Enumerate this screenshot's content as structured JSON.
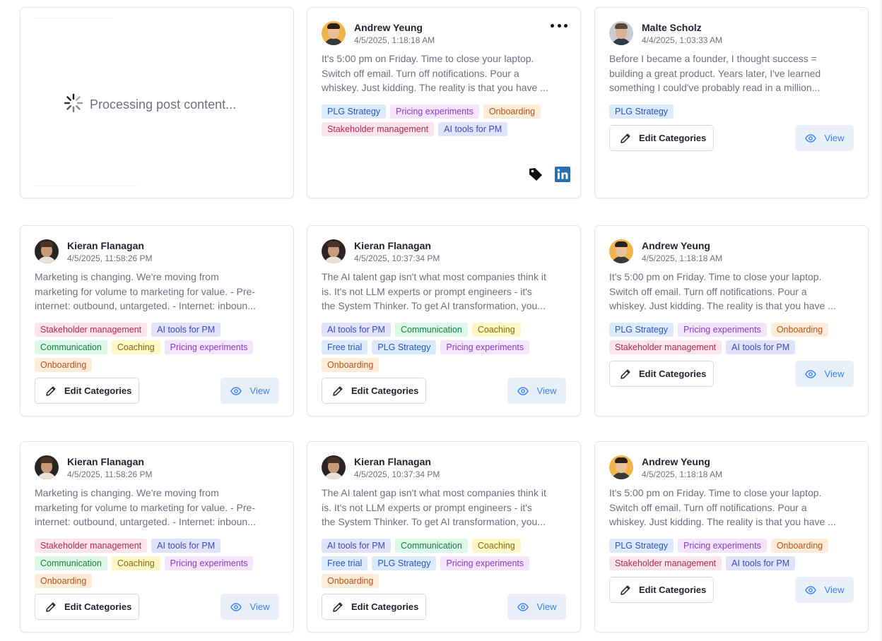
{
  "processing_card": {
    "label": "Processing post content..."
  },
  "labels": {
    "edit": "Edit Categories",
    "view": "View"
  },
  "colors": {
    "view_accent": "#3b82f6",
    "linkedin": "#2a6fb0",
    "tag_blue": "#dbeafe",
    "tag_indigo": "#e0e3fc",
    "tag_purple": "#f2e5fd",
    "tag_orange": "#feecd8",
    "tag_pink": "#fce4ec",
    "tag_green": "#dcf7e5",
    "tag_yellow": "#fef6c4"
  },
  "posts": [
    {
      "author": "Andrew Yeung",
      "date": "4/5/2025, 1:18:18 AM",
      "lines": [
        "It's 5:00 pm on Friday. Time to close your laptop.",
        "Switch off email. Turn off notifications. Pour a",
        "whiskey. Just kidding. The reality is that you have ..."
      ],
      "tags": [
        "PLG Strategy",
        "Pricing experiments",
        "Onboarding",
        "Stakeholder management",
        "AI tools for PM"
      ]
    },
    {
      "author": "Malte Scholz",
      "date": "4/4/2025, 1:03:33 AM",
      "lines": [
        "Before I became a founder, I thought success =",
        "building a great product. Years later, I've learned",
        "something I could've probably read in a million..."
      ],
      "tags": [
        "PLG Strategy"
      ]
    },
    {
      "author": "Kieran Flanagan",
      "date": "4/5/2025, 11:58:26 PM",
      "lines": [
        "Marketing is changing. We're moving from",
        "marketing for volume to marketing for value. - Pre-",
        "internet: outbound, untargeted. - Internet: inboun..."
      ],
      "tags": [
        "Stakeholder management",
        "AI tools for PM",
        "Communication",
        "Coaching",
        "Pricing experiments",
        "Onboarding"
      ]
    },
    {
      "author": "Kieran Flanagan",
      "date": "4/5/2025, 10:37:34 PM",
      "lines": [
        "The AI talent gap isn't what most companies think it",
        "is. It's not LLM experts or prompt engineers - it's",
        "the System Thinker. To get AI transformation, you..."
      ],
      "tags": [
        "AI tools for PM",
        "Communication",
        "Coaching",
        "Free trial",
        "PLG Strategy",
        "Pricing experiments",
        "Onboarding"
      ]
    },
    {
      "author": "Andrew Yeung",
      "date": "4/5/2025, 1:18:18 AM",
      "lines": [
        "It's 5:00 pm on Friday. Time to close your laptop.",
        "Switch off email. Turn off notifications. Pour a",
        "whiskey. Just kidding. The reality is that you have ..."
      ],
      "tags": [
        "PLG Strategy",
        "Pricing experiments",
        "Onboarding",
        "Stakeholder management",
        "AI tools for PM"
      ]
    },
    {
      "author": "Kieran Flanagan",
      "date": "4/5/2025, 11:58:26 PM",
      "lines": [
        "Marketing is changing. We're moving from",
        "marketing for volume to marketing for value. - Pre-",
        "internet: outbound, untargeted. - Internet: inboun..."
      ],
      "tags": [
        "Stakeholder management",
        "AI tools for PM",
        "Communication",
        "Coaching",
        "Pricing experiments",
        "Onboarding"
      ]
    },
    {
      "author": "Kieran Flanagan",
      "date": "4/5/2025, 10:37:34 PM",
      "lines": [
        "The AI talent gap isn't what most companies think it",
        "is. It's not LLM experts or prompt engineers - it's",
        "the System Thinker. To get AI transformation, you..."
      ],
      "tags": [
        "AI tools for PM",
        "Communication",
        "Coaching",
        "Free trial",
        "PLG Strategy",
        "Pricing experiments",
        "Onboarding"
      ]
    },
    {
      "author": "Andrew Yeung",
      "date": "4/5/2025, 1:18:18 AM",
      "lines": [
        "It's 5:00 pm on Friday. Time to close your laptop.",
        "Switch off email. Turn off notifications. Pour a",
        "whiskey. Just kidding. The reality is that you have ..."
      ],
      "tags": [
        "PLG Strategy",
        "Pricing experiments",
        "Onboarding",
        "Stakeholder management",
        "AI tools for PM"
      ]
    }
  ]
}
